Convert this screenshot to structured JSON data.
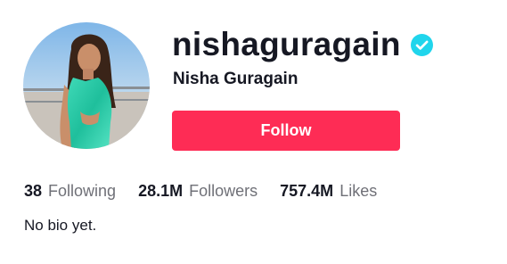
{
  "profile": {
    "username": "nishaguragain",
    "nickname": "Nisha Guragain",
    "verified": true,
    "follow_label": "Follow",
    "bio": "No bio yet."
  },
  "stats": {
    "following": {
      "value": "38",
      "label": "Following"
    },
    "followers": {
      "value": "28.1M",
      "label": "Followers"
    },
    "likes": {
      "value": "757.4M",
      "label": "Likes"
    }
  },
  "colors": {
    "follow_button": "#fe2c55",
    "verified_badge": "#20d5ec",
    "text_primary": "#161823",
    "text_secondary": "#6f7077"
  },
  "icons": {
    "verified": "verified-badge-icon"
  }
}
